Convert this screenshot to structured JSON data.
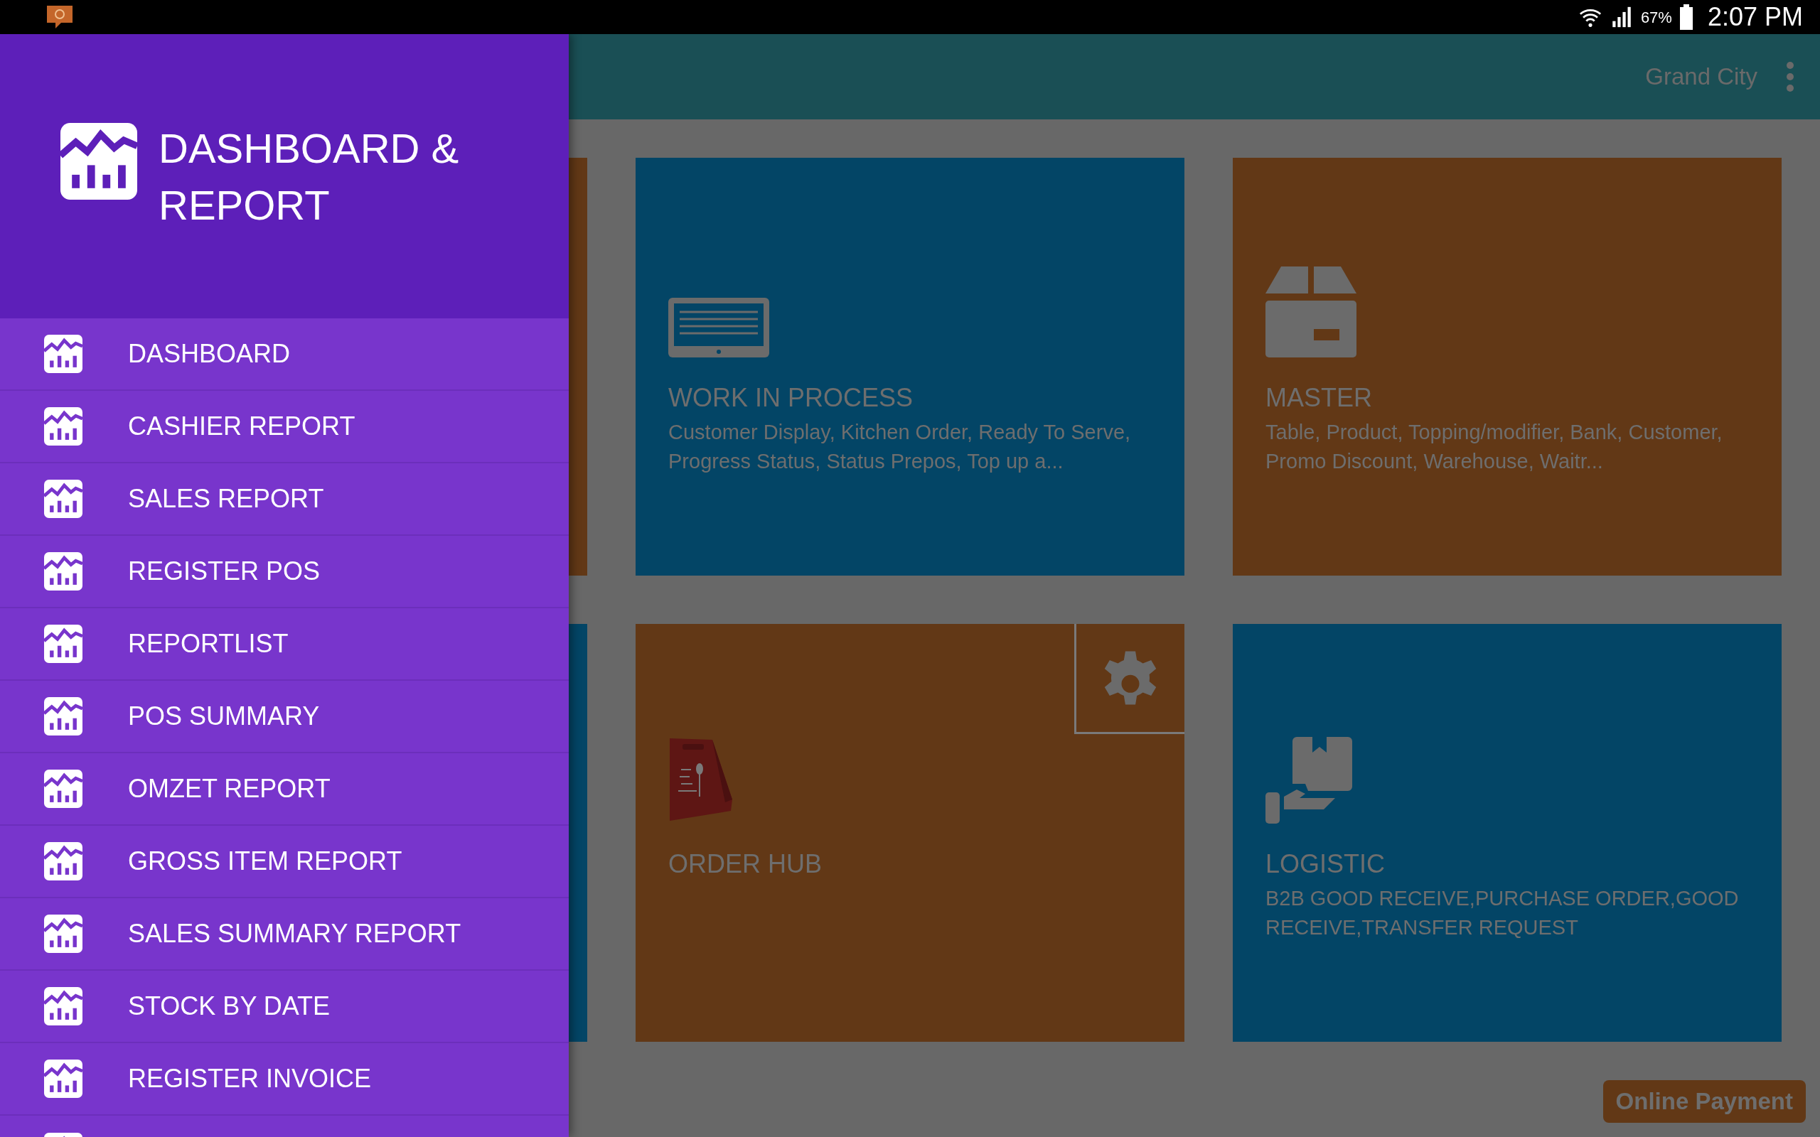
{
  "status_bar": {
    "battery": "67%",
    "time": "2:07 PM"
  },
  "app_bar": {
    "location": "Grand City"
  },
  "drawer": {
    "title": "DASHBOARD & REPORT",
    "items": [
      {
        "label": "DASHBOARD"
      },
      {
        "label": "CASHIER REPORT"
      },
      {
        "label": "SALES REPORT"
      },
      {
        "label": "REGISTER POS"
      },
      {
        "label": "REPORTLIST"
      },
      {
        "label": "POS SUMMARY"
      },
      {
        "label": "OMZET REPORT"
      },
      {
        "label": "GROSS ITEM REPORT"
      },
      {
        "label": "SALES SUMMARY REPORT"
      },
      {
        "label": "STOCK BY DATE"
      },
      {
        "label": "REGISTER INVOICE"
      }
    ]
  },
  "tiles": [
    {
      "kind": "monitor",
      "title": "WORK IN PROCESS",
      "description": "Customer Display, Kitchen Order, Ready To Serve, Progress Status, Status Prepos, Top up a...",
      "color": "#034566"
    },
    {
      "kind": "box",
      "title": "MASTER",
      "description": "Table, Product, Topping/modifier, Bank, Customer, Promo Discount, Warehouse, Waitr...",
      "color": "#623816"
    },
    {
      "kind": "bag",
      "title": "ORDER HUB",
      "color": "#623816",
      "settings": true
    },
    {
      "kind": "hand",
      "title": "LOGISTIC",
      "description": "B2B GOOD RECEIVE,PURCHASE ORDER,GOOD RECEIVE,TRANSFER REQUEST",
      "color": "#034566"
    }
  ],
  "online_payment": {
    "label": "Online Payment"
  }
}
